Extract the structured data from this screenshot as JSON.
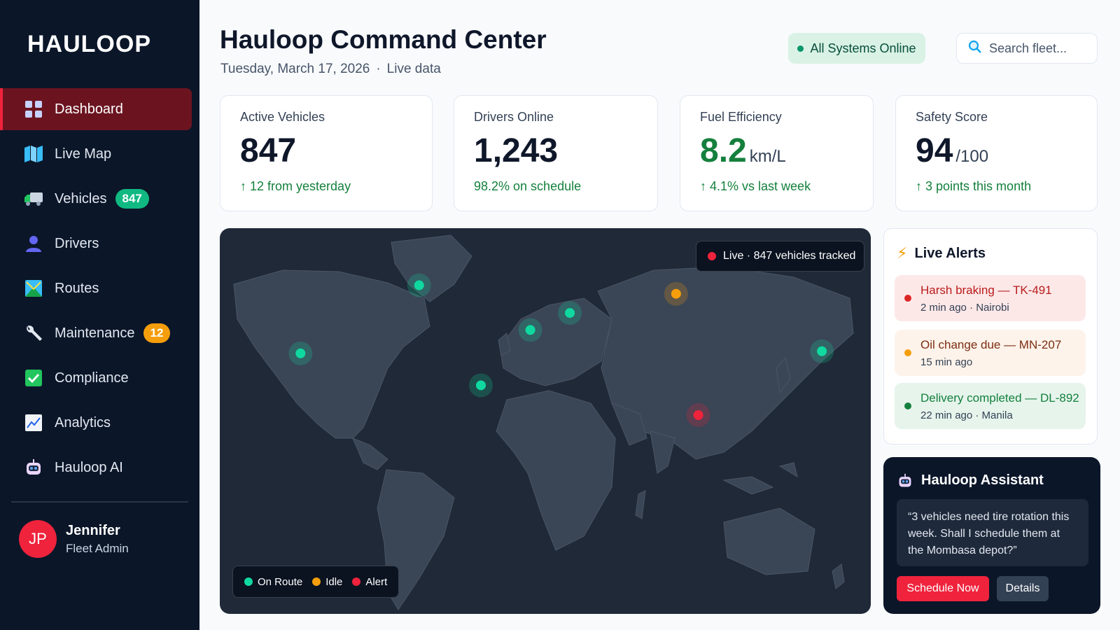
{
  "sidebar": {
    "brand": "HAULOOP",
    "items": [
      {
        "label": "Dashboard",
        "icon": "grid-icon",
        "active": true
      },
      {
        "label": "Live Map",
        "icon": "map-icon"
      },
      {
        "label": "Vehicles",
        "icon": "truck-icon",
        "badge": "847"
      },
      {
        "label": "Drivers",
        "icon": "person-icon"
      },
      {
        "label": "Routes",
        "icon": "route-icon"
      },
      {
        "label": "Maintenance",
        "icon": "wrench-icon",
        "badge": "12"
      },
      {
        "label": "Compliance",
        "icon": "checkbox-icon"
      },
      {
        "label": "Analytics",
        "icon": "chart-icon"
      },
      {
        "label": "Hauloop AI",
        "icon": "robot-icon"
      }
    ],
    "user": {
      "initials": "JP",
      "name": "Jennifer",
      "role": "Fleet Admin"
    }
  },
  "header": {
    "title": "Hauloop Command Center",
    "date": "Tuesday, March 17, 2026",
    "separator": "·",
    "live": "Live data",
    "status": "All Systems Online",
    "search_placeholder": "Search fleet..."
  },
  "stats": [
    {
      "label": "Active Vehicles",
      "value": "847",
      "unit": "",
      "trend": "↑ 12 from yesterday"
    },
    {
      "label": "Drivers Online",
      "value": "1,243",
      "unit": "",
      "trend": "98.2% on schedule"
    },
    {
      "label": "Fuel Efficiency",
      "value": "8.2",
      "unit": "km/L",
      "trend": "↑ 4.1% vs last week"
    },
    {
      "label": "Safety Score",
      "value": "94",
      "unit": "/100",
      "trend": "↑ 3 points this month"
    }
  ],
  "map": {
    "live_label": "Live · 847 vehicles tracked",
    "legend": [
      {
        "label": "On Route",
        "color": "#10d9a0"
      },
      {
        "label": "Idle",
        "color": "#f59e0b"
      },
      {
        "label": "Alert",
        "color": "#ef233c"
      }
    ],
    "markers": [
      {
        "status": "route",
        "lon": -42,
        "lat": 61
      },
      {
        "status": "idle",
        "lon": 62,
        "lat": 57
      },
      {
        "status": "route",
        "lon": 19,
        "lat": 48
      },
      {
        "status": "route",
        "lon": 3,
        "lat": 40
      },
      {
        "status": "route",
        "lon": 121,
        "lat": 30
      },
      {
        "status": "route",
        "lon": -90,
        "lat": 29
      },
      {
        "status": "route",
        "lon": -17,
        "lat": 14
      },
      {
        "status": "alert",
        "lon": 71,
        "lat": 0
      }
    ]
  },
  "alerts": {
    "title": "Live Alerts",
    "items": [
      {
        "title": "Harsh braking — TK-491",
        "meta": "2 min ago · Nairobi",
        "level": "red"
      },
      {
        "title": "Oil change due — MN-207",
        "meta": "15 min ago",
        "level": "amber"
      },
      {
        "title": "Delivery completed — DL-892",
        "meta": "22 min ago · Manila",
        "level": "green"
      }
    ]
  },
  "assistant": {
    "title": "Hauloop Assistant",
    "message": "“3 vehicles need tire rotation this week. Shall I schedule them at the Mombasa depot?”",
    "primary": "Schedule Now",
    "secondary": "Details"
  },
  "colors": {
    "accent": "#ef233c",
    "sidebar_bg": "#0b1629",
    "success": "#15803d",
    "warning": "#f59e0b",
    "map_bg": "#1f2937"
  }
}
